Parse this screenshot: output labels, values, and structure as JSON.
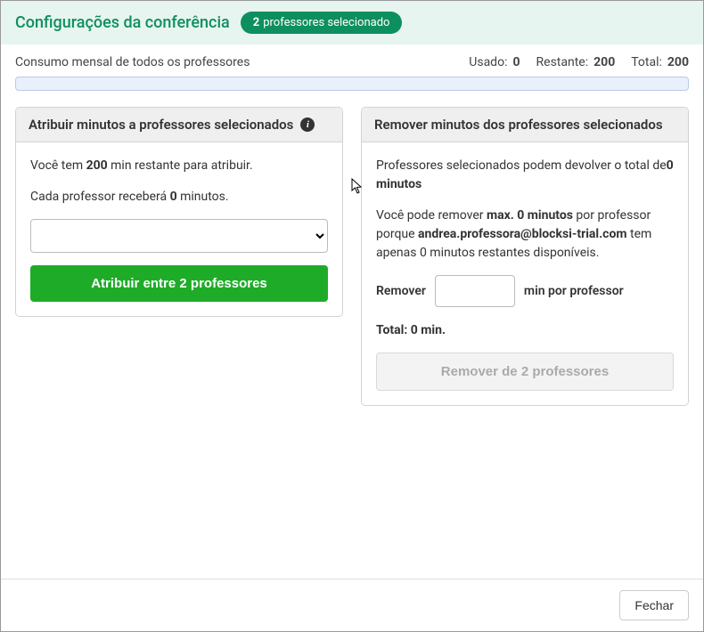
{
  "header": {
    "title": "Configurações da conferência",
    "badge_count": "2",
    "badge_text": "professores selecionado"
  },
  "usage": {
    "label": "Consumo mensal de todos os professores",
    "used_label": "Usado:",
    "used_value": "0",
    "remaining_label": "Restante:",
    "remaining_value": "200",
    "total_label": "Total:",
    "total_value": "200"
  },
  "assign_panel": {
    "title": "Atribuir minutos a professores selecionados",
    "line1_pre": "Você tem ",
    "line1_mid": "200",
    "line1_post": " min restante para atribuir.",
    "line2_pre": "Cada professor receberá ",
    "line2_mid": "0",
    "line2_post": " minutos.",
    "button": "Atribuir entre 2 professores"
  },
  "remove_panel": {
    "title": "Remover minutos dos professores selecionados",
    "line1_pre": "Professores selecionados podem devolver o total de",
    "line1_val": "0 minutos",
    "line2_pre": "Você pode remover ",
    "line2_bold1": "max. 0 minutos",
    "line2_mid": " por professor porque ",
    "line2_email": "andrea.professora@blocksi-trial.com",
    "line2_post": " tem apenas 0 minutos restantes disponíveis.",
    "remove_label_pre": "Remover",
    "remove_label_post": "min por professor",
    "total_label": "Total: 0 min.",
    "button": "Remover de 2 professores"
  },
  "footer": {
    "close": "Fechar"
  }
}
